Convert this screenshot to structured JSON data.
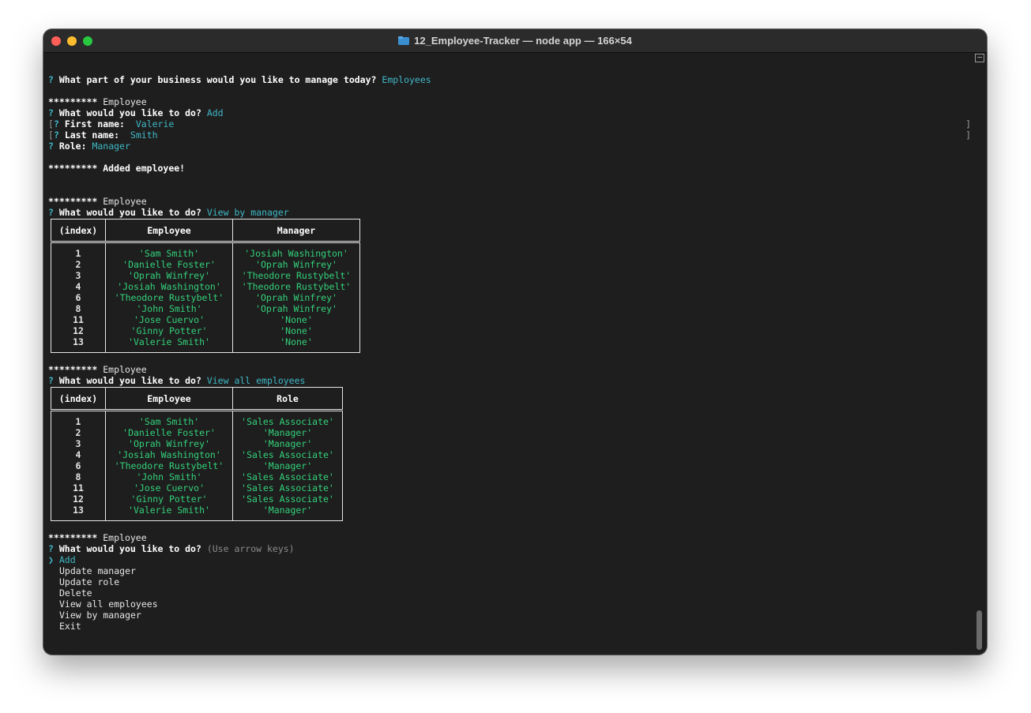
{
  "window": {
    "title": "12_Employee-Tracker — node app — 166×54"
  },
  "terminal": {
    "prompt_mark": "?",
    "stars": "*********",
    "q_business": "What part of your business would you like to manage today?",
    "a_business": "Employees",
    "section_employee": "Employee",
    "q_do": "What would you like to do?",
    "a_add": "Add",
    "q_first": "First name:",
    "a_first": "Valerie",
    "q_last": "Last name:",
    "a_last": "Smith",
    "q_role": "Role:",
    "a_role": "Manager",
    "added_msg": "Added employee!",
    "a_view_manager": "View by manager",
    "a_view_all": "View all employees",
    "hint": "(Use arrow keys)",
    "pointer": "❯",
    "menu": [
      "Add",
      "Update manager",
      "Update role",
      "Delete",
      "View all employees",
      "View by manager",
      "Exit"
    ]
  },
  "table_manager": {
    "headers": [
      "(index)",
      "Employee",
      "Manager"
    ],
    "rows": [
      [
        "1",
        "'Sam Smith'",
        "'Josiah Washington'"
      ],
      [
        "2",
        "'Danielle Foster'",
        "'Oprah Winfrey'"
      ],
      [
        "3",
        "'Oprah Winfrey'",
        "'Theodore Rustybelt'"
      ],
      [
        "4",
        "'Josiah Washington'",
        "'Theodore Rustybelt'"
      ],
      [
        "6",
        "'Theodore Rustybelt'",
        "'Oprah Winfrey'"
      ],
      [
        "8",
        "'John Smith'",
        "'Oprah Winfrey'"
      ],
      [
        "11",
        "'Jose Cuervo'",
        "'None'"
      ],
      [
        "12",
        "'Ginny Potter'",
        "'None'"
      ],
      [
        "13",
        "'Valerie Smith'",
        "'None'"
      ]
    ]
  },
  "table_role": {
    "headers": [
      "(index)",
      "Employee",
      "Role"
    ],
    "rows": [
      [
        "1",
        "'Sam Smith'",
        "'Sales Associate'"
      ],
      [
        "2",
        "'Danielle Foster'",
        "'Manager'"
      ],
      [
        "3",
        "'Oprah Winfrey'",
        "'Manager'"
      ],
      [
        "4",
        "'Josiah Washington'",
        "'Sales Associate'"
      ],
      [
        "6",
        "'Theodore Rustybelt'",
        "'Manager'"
      ],
      [
        "8",
        "'John Smith'",
        "'Sales Associate'"
      ],
      [
        "11",
        "'Jose Cuervo'",
        "'Sales Associate'"
      ],
      [
        "12",
        "'Ginny Potter'",
        "'Sales Associate'"
      ],
      [
        "13",
        "'Valerie Smith'",
        "'Manager'"
      ]
    ]
  },
  "colors": {
    "answer": "#3fb8c7",
    "value": "#33d17a",
    "background": "#1e1e1e"
  }
}
